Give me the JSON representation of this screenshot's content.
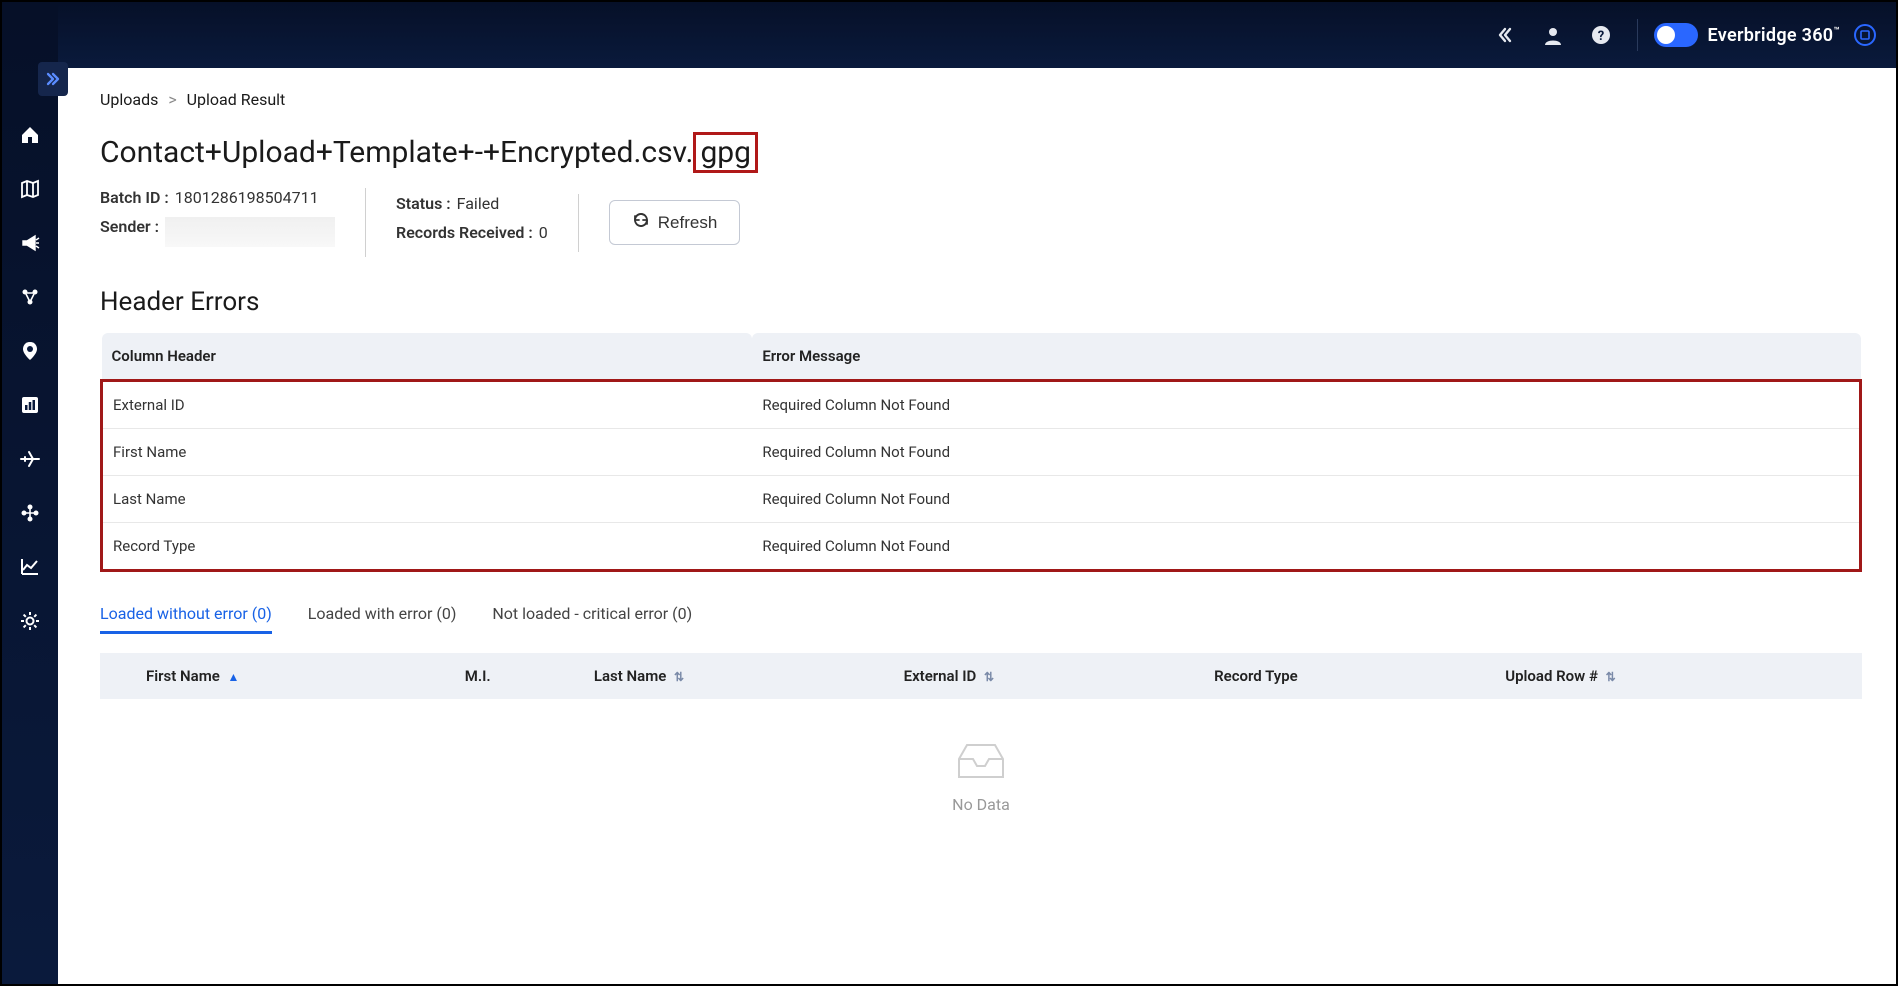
{
  "header": {
    "brand_text": "Everbridge 360",
    "brand_tm": "™"
  },
  "breadcrumb": {
    "root": "Uploads",
    "current": "Upload Result"
  },
  "page": {
    "title_base": "Contact+Upload+Template+-+Encrypted.csv.",
    "title_highlight": "gpg"
  },
  "info": {
    "batch_id_label": "Batch ID :",
    "batch_id_value": "1801286198504711",
    "sender_label": "Sender :",
    "status_label": "Status :",
    "status_value": "Failed",
    "records_received_label": "Records Received :",
    "records_received_value": "0",
    "refresh_label": "Refresh"
  },
  "header_errors": {
    "title": "Header Errors",
    "columns": {
      "col1": "Column Header",
      "col2": "Error Message"
    },
    "rows": [
      {
        "header": "External ID",
        "message": "Required Column Not Found"
      },
      {
        "header": "First Name",
        "message": "Required Column Not Found"
      },
      {
        "header": "Last Name",
        "message": "Required Column Not Found"
      },
      {
        "header": "Record Type",
        "message": "Required Column Not Found"
      }
    ]
  },
  "tabs": {
    "t0": "Loaded without error (0)",
    "t1": "Loaded with error (0)",
    "t2": "Not loaded - critical error (0)"
  },
  "data_table": {
    "columns": {
      "first_name": "First Name",
      "mi": "M.I.",
      "last_name": "Last Name",
      "external_id": "External ID",
      "record_type": "Record Type",
      "upload_row": "Upload Row #"
    },
    "no_data": "No Data"
  }
}
